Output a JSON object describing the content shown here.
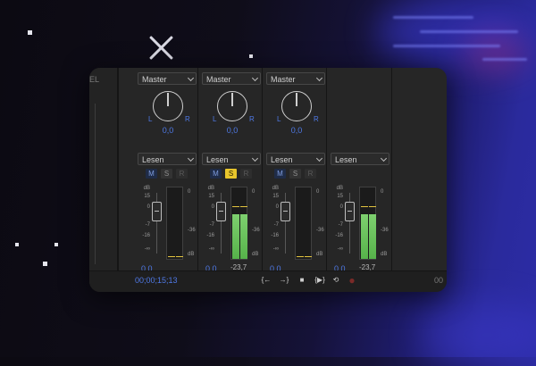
{
  "channels": [
    {
      "send": "Master",
      "pan_l": "L",
      "pan_r": "R",
      "pan_value": "0,0",
      "mode": "Lesen",
      "m": "M",
      "s": "S",
      "r": "R",
      "scale": [
        "dB",
        "15",
        "0",
        "-7",
        "-16",
        "-∞"
      ],
      "meter_scale": [
        "0",
        "-36",
        "dB"
      ],
      "volume": "0,0",
      "level_db": "",
      "meter_fill": 0,
      "solo_active": false
    },
    {
      "send": "Master",
      "pan_l": "L",
      "pan_r": "R",
      "pan_value": "0,0",
      "mode": "Lesen",
      "m": "M",
      "s": "S",
      "r": "R",
      "scale": [
        "dB",
        "15",
        "0",
        "-7",
        "-16",
        "-∞"
      ],
      "meter_scale": [
        "0",
        "-36",
        "dB"
      ],
      "volume": "0,0",
      "level_db": "-23,7",
      "meter_fill": 0.62,
      "solo_active": true
    },
    {
      "send": "Master",
      "pan_l": "L",
      "pan_r": "R",
      "pan_value": "0,0",
      "mode": "Lesen",
      "m": "M",
      "s": "S",
      "r": "R",
      "scale": [
        "dB",
        "15",
        "0",
        "-7",
        "-16",
        "-∞"
      ],
      "meter_scale": [
        "0",
        "-36",
        "dB"
      ],
      "volume": "0,0",
      "level_db": "",
      "meter_fill": 0,
      "solo_active": false
    },
    {
      "mode": "Lesen",
      "scale": [
        "dB",
        "15",
        "0",
        "-7",
        "-16",
        "-∞"
      ],
      "meter_scale": [
        "0",
        "-36",
        "dB"
      ],
      "volume": "0,0",
      "level_db": "-23,7",
      "meter_fill": 0.62
    }
  ],
  "left_strip_text": "EL",
  "timecode": "00;00;15;13",
  "transport": {
    "goto_in": "{←",
    "goto_out": "→}",
    "stop": "■",
    "play_in_out": "{▶}",
    "loop": "⟲",
    "record": "●"
  },
  "right_stub": "00",
  "colors": {
    "accent": "#4f79e6",
    "solo": "#e8c52c",
    "meter": "#6cc35d"
  }
}
